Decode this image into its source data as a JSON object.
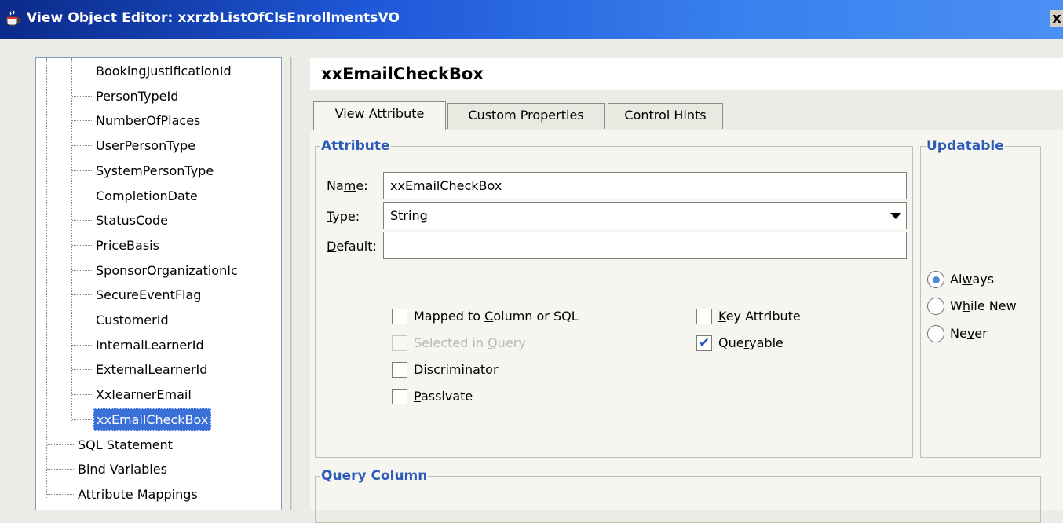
{
  "window": {
    "title": "View Object Editor: xxrzbListOfClsEnrollmentsVO",
    "close_label": "x"
  },
  "tree": {
    "items": [
      {
        "label": "BookingJustificationId",
        "level": 2
      },
      {
        "label": "PersonTypeId",
        "level": 2
      },
      {
        "label": "NumberOfPlaces",
        "level": 2
      },
      {
        "label": "UserPersonType",
        "level": 2
      },
      {
        "label": "SystemPersonType",
        "level": 2
      },
      {
        "label": "CompletionDate",
        "level": 2
      },
      {
        "label": "StatusCode",
        "level": 2
      },
      {
        "label": "PriceBasis",
        "level": 2
      },
      {
        "label": "SponsorOrganizationIc",
        "level": 2
      },
      {
        "label": "SecureEventFlag",
        "level": 2
      },
      {
        "label": "CustomerId",
        "level": 2
      },
      {
        "label": "InternalLearnerId",
        "level": 2
      },
      {
        "label": "ExternalLearnerId",
        "level": 2
      },
      {
        "label": "XxlearnerEmail",
        "level": 2
      },
      {
        "label": "xxEmailCheckBox",
        "level": 2,
        "selected": true
      },
      {
        "label": "SQL Statement",
        "level": 1
      },
      {
        "label": "Bind Variables",
        "level": 1
      },
      {
        "label": "Attribute Mappings",
        "level": 1
      }
    ]
  },
  "header": {
    "attribute_name": "xxEmailCheckBox"
  },
  "tabs": [
    {
      "label": "View Attribute",
      "active": true
    },
    {
      "label": "Custom Properties",
      "active": false
    },
    {
      "label": "Control Hints",
      "active": false
    }
  ],
  "attribute_group": {
    "title": "Attribute",
    "name_label_pre": "Na",
    "name_label_ul": "m",
    "name_label_post": "e:",
    "name_value": "xxEmailCheckBox",
    "type_label_ul": "T",
    "type_label_post": "ype:",
    "type_value": "String",
    "default_label_ul": "D",
    "default_label_post": "efault:",
    "default_value": ""
  },
  "checkboxes": {
    "mapped": {
      "pre": "Mapped to ",
      "ul": "C",
      "post": "olumn or SQL",
      "checked": false,
      "enabled": true
    },
    "selected_in_query": {
      "pre": "Selected in ",
      "ul": "Q",
      "post": "uery",
      "checked": false,
      "enabled": false
    },
    "discriminator": {
      "pre": "Dis",
      "ul": "c",
      "post": "riminator",
      "checked": false,
      "enabled": true
    },
    "passivate": {
      "pre": "",
      "ul": "P",
      "post": "assivate",
      "checked": false,
      "enabled": true
    },
    "key_attribute": {
      "pre": "",
      "ul": "K",
      "post": "ey Attribute",
      "checked": false,
      "enabled": true
    },
    "queryable": {
      "pre": "Que",
      "ul": "r",
      "post": "yable",
      "checked": true,
      "enabled": true
    }
  },
  "updatable_group": {
    "title": "Updatable",
    "options": [
      {
        "pre": "Al",
        "ul": "w",
        "post": "ays",
        "selected": true
      },
      {
        "pre": "W",
        "ul": "h",
        "post": "ile New",
        "selected": false
      },
      {
        "pre": "Ne",
        "ul": "v",
        "post": "er",
        "selected": false
      }
    ]
  },
  "query_column_group": {
    "title": "Query Column"
  },
  "colors": {
    "title_bar": "#1f58d8",
    "group_title": "#2c5bb8",
    "tree_selection": "#3c70d9"
  }
}
